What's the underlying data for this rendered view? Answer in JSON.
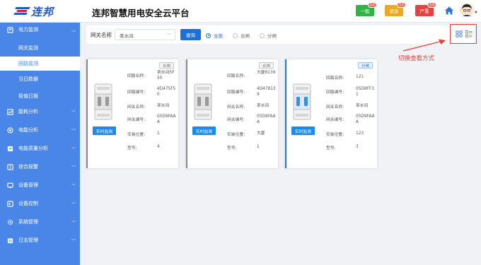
{
  "header": {
    "logo_text": "连邦",
    "title": "连邦智慧用电安全云平台",
    "alarms": [
      {
        "label": "一般",
        "count": "12",
        "color": "#2fb344"
      },
      {
        "label": "紧急",
        "count": "12",
        "color": "#f0a81c"
      },
      {
        "label": "严重",
        "count": "12",
        "color": "#e94040"
      }
    ]
  },
  "sidebar": {
    "items": [
      {
        "label": "电力监测",
        "icon": "power-monitor-icon"
      },
      {
        "label": "能耗分析",
        "icon": "energy-chart-icon"
      },
      {
        "label": "电能分析",
        "icon": "power-analysis-icon"
      },
      {
        "label": "电能质量分析",
        "icon": "quality-analysis-icon"
      },
      {
        "label": "综合报警",
        "icon": "alarm-bell-icon"
      },
      {
        "label": "设备管理",
        "icon": "device-manage-icon"
      },
      {
        "label": "设备控制",
        "icon": "device-control-icon"
      },
      {
        "label": "系统管理",
        "icon": "gear-icon"
      },
      {
        "label": "日志管理",
        "icon": "log-icon"
      }
    ],
    "sub_items": [
      {
        "label": "网关监测"
      },
      {
        "label": "回路监测"
      },
      {
        "label": "当日数据"
      },
      {
        "label": "极值日报"
      }
    ],
    "active_sub": "回路监测"
  },
  "filter": {
    "gateway_label": "网关名称",
    "gateway_value": "茶水间",
    "query_label": "查询",
    "radios": [
      {
        "label": "全部",
        "checked": true
      },
      {
        "label": "合闸",
        "checked": false
      },
      {
        "label": "分闸",
        "checked": false
      }
    ]
  },
  "annotation": "切换查看方式",
  "field_labels": {
    "loop_name": "回路名称:",
    "loop_no": "回路编号:",
    "gateway_name": "网关名称:",
    "gateway_no": "网关编号:",
    "location": "安装位置:",
    "model": "型号:"
  },
  "monitor_label": "实时监测",
  "cards": [
    {
      "status": "合闸",
      "loop_name": "茶水间5F50",
      "loop_no": "4D475F50",
      "gateway_name": "茶水间",
      "gateway_no": "05D9FAAA",
      "location": "1",
      "model": "4"
    },
    {
      "status": "合闸",
      "loop_name": "大厦8139",
      "loop_no": "4D478139",
      "gateway_name": "茶水间",
      "gateway_no": "05D9FAAA",
      "location": "大厦",
      "model": "1"
    },
    {
      "status": "分闸",
      "loop_name": "121",
      "loop_no": "05D8FF31",
      "gateway_name": "茶水间",
      "gateway_no": "05D9FAAA",
      "location": "123",
      "model": "3"
    }
  ]
}
